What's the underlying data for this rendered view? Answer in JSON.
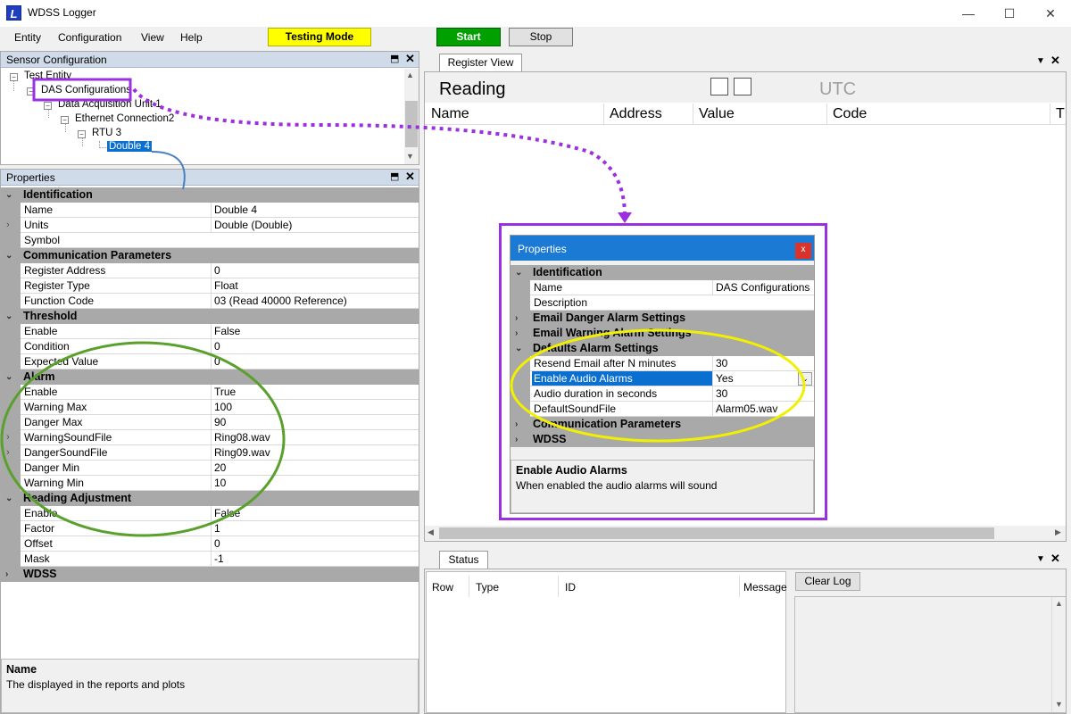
{
  "window": {
    "title": "WDSS Logger",
    "app_icon": "L",
    "minimize": "—",
    "maximize": "☐",
    "close": "✕"
  },
  "menu": {
    "items": [
      "Entity",
      "Configuration",
      "View",
      "Help"
    ],
    "testing_mode": "Testing Mode",
    "start": "Start",
    "stop": "Stop"
  },
  "sensor_config": {
    "title": "Sensor Configuration",
    "pin": "⬒",
    "close": "✕",
    "tree": [
      "Test Entity",
      "DAS Configurations",
      "Data Acquisition Unit 1",
      "Ethernet Connection2",
      "RTU 3",
      "Double 4"
    ]
  },
  "properties": {
    "title": "Properties",
    "categories": {
      "identification": "Identification",
      "communication": "Communication Parameters",
      "threshold": "Threshold",
      "alarm": "Alarm",
      "reading_adjustment": "Reading Adjustment",
      "wdss": "WDSS"
    },
    "identification": [
      {
        "name": "Name",
        "value": "Double 4"
      },
      {
        "name": "Units",
        "value": "Double (Double)"
      },
      {
        "name": "Symbol",
        "value": ""
      }
    ],
    "communication": [
      {
        "name": "Register Address",
        "value": "0"
      },
      {
        "name": "Register Type",
        "value": "Float"
      },
      {
        "name": "Function Code",
        "value": "03 (Read 40000 Reference)"
      }
    ],
    "threshold": [
      {
        "name": "Enable",
        "value": "False"
      },
      {
        "name": "Condition",
        "value": "0"
      },
      {
        "name": "Expected Value",
        "value": "0"
      }
    ],
    "alarm": [
      {
        "name": "Enable",
        "value": "True"
      },
      {
        "name": "Warning Max",
        "value": "100"
      },
      {
        "name": "Danger Max",
        "value": "90"
      },
      {
        "name": "WarningSoundFile",
        "value": "Ring08.wav"
      },
      {
        "name": "DangerSoundFile",
        "value": "Ring09.wav"
      },
      {
        "name": "Danger Min",
        "value": "20"
      },
      {
        "name": "Warning Min",
        "value": "10"
      }
    ],
    "reading_adjustment": [
      {
        "name": "Enable",
        "value": "False"
      },
      {
        "name": "Factor",
        "value": "1"
      },
      {
        "name": "Offset",
        "value": "0"
      },
      {
        "name": "Mask",
        "value": "-1"
      }
    ],
    "help_title": "Name",
    "help_desc": "The displayed in the reports and plots"
  },
  "register_view": {
    "tab": "Register View",
    "reading": "Reading",
    "utc": "UTC",
    "columns": [
      "Name",
      "Address",
      "Value",
      "Code",
      "T"
    ]
  },
  "popup": {
    "title": "Properties",
    "close": "x",
    "cat_identification": "Identification",
    "identification": [
      {
        "name": "Name",
        "value": "DAS Configurations"
      },
      {
        "name": "Description",
        "value": ""
      }
    ],
    "cat_email_danger": "Email Danger Alarm Settings",
    "cat_email_warning": "Email Warning Alarm Settings",
    "cat_defaults": "Defaults Alarm Settings",
    "defaults": [
      {
        "name": "Resend Email after N minutes",
        "value": "30"
      },
      {
        "name": "Enable Audio Alarms",
        "value": "Yes"
      },
      {
        "name": "Audio duration in seconds",
        "value": "30"
      },
      {
        "name": "DefaultSoundFile",
        "value": "Alarm05.wav"
      }
    ],
    "cat_comm": "Communication Parameters",
    "cat_wdss": "WDSS",
    "help_title": "Enable Audio Alarms",
    "help_desc": "When enabled the audio alarms will sound"
  },
  "status": {
    "tab": "Status",
    "columns": [
      "Row",
      "Type",
      "ID",
      "Message"
    ],
    "clear_log": "Clear Log"
  },
  "colors": {
    "testing_mode_bg": "#ffff00",
    "start_bg": "#00a000",
    "highlight_purple": "#9b30e0",
    "circle_green": "#5aa02c",
    "circle_yellow": "#f0f000",
    "selection_blue": "#0a6fcf"
  }
}
